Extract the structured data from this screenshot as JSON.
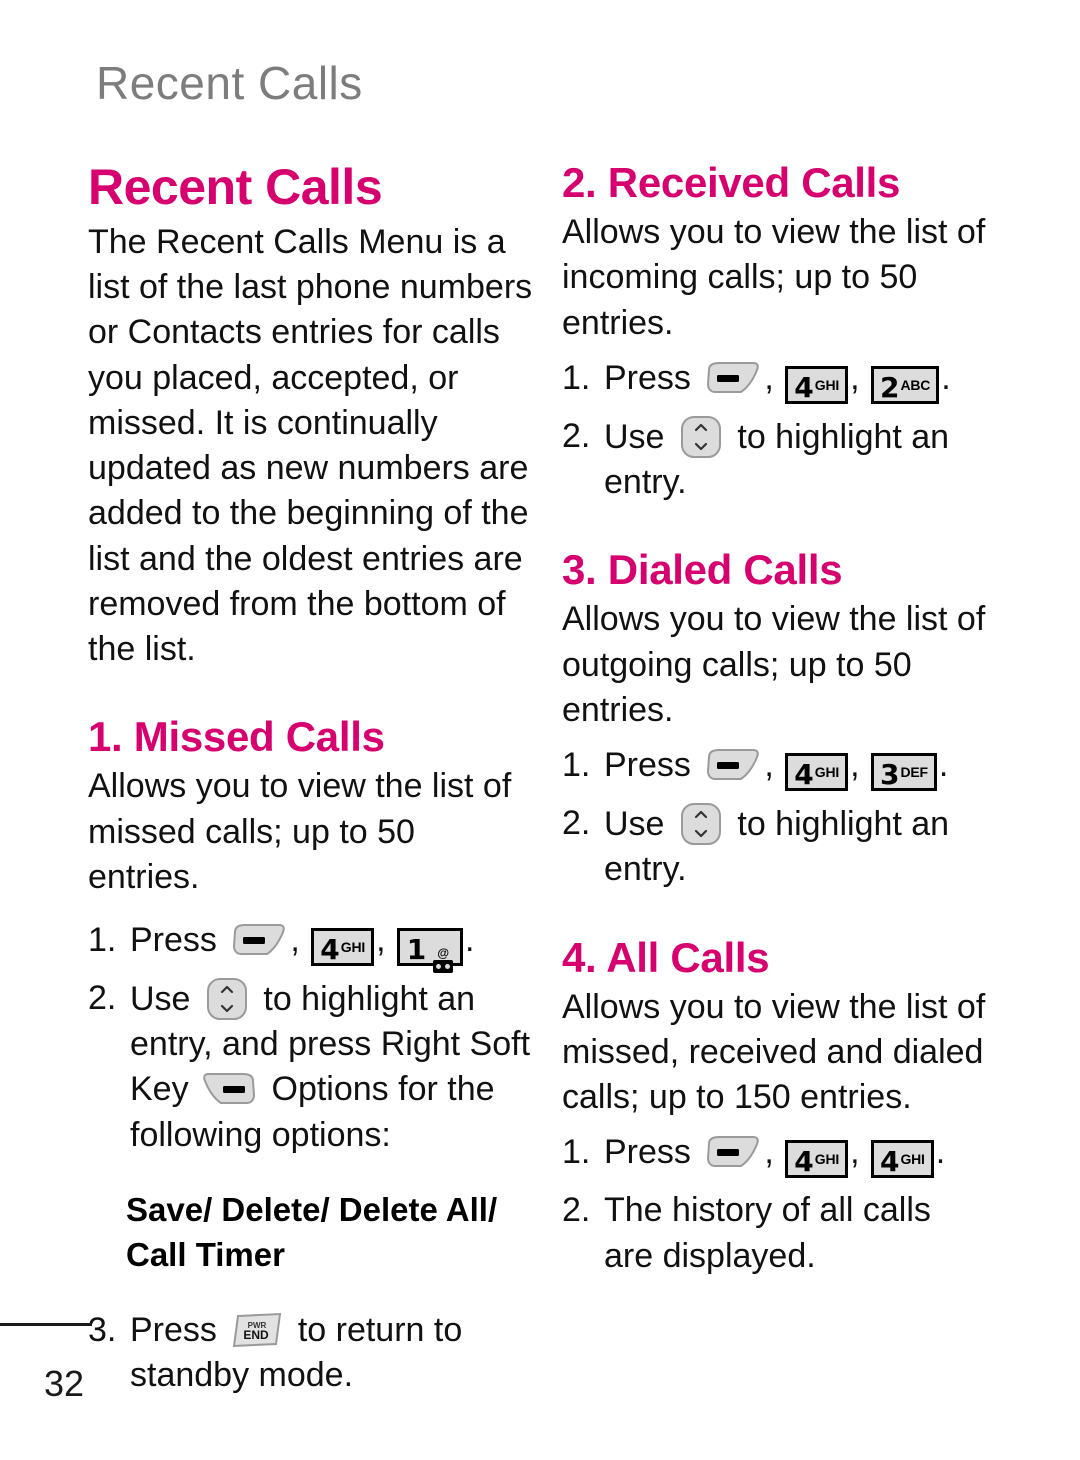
{
  "page": {
    "running_head": "Recent Calls",
    "page_number": "32",
    "accent_color": "#d6006e",
    "header_color": "#7d7d7d",
    "text_color": "#111111"
  },
  "left_column": {
    "title": "Recent Calls",
    "intro": "The Recent Calls Menu is a list of the last phone numbers or Contacts entries for calls you placed, accepted, or missed. It is continually updated as new numbers are added to the beginning of the list and the oldest entries are removed from the bottom of the list.",
    "section": {
      "heading": "1. Missed Calls",
      "description": "Allows you to view the list of missed calls; up to 50 entries.",
      "steps": [
        {
          "num": "1.",
          "pre": "Press",
          "keys": [
            "send-key",
            "4-ghi-key",
            "1-voicemail-key"
          ],
          "post": "."
        },
        {
          "num": "2.",
          "pre": "Use",
          "keys": [
            "nav-key"
          ],
          "post": "to highlight an entry, and press Right Soft Key",
          "post_keys": [
            "right-soft-key"
          ],
          "tail": "Options for the following options:"
        },
        {
          "num": "3.",
          "pre": "Press",
          "keys": [
            "pwr-end-key"
          ],
          "post": "to return to standby mode."
        }
      ],
      "options_bold": "Save/ Delete/ Delete All/ Call Timer"
    }
  },
  "right_column": {
    "sections": [
      {
        "heading": "2. Received Calls",
        "description": "Allows you to view the list of incoming calls; up to 50 entries.",
        "steps": [
          {
            "num": "1.",
            "pre": "Press",
            "keys": [
              "send-key",
              "4-ghi-key",
              "2-abc-key"
            ],
            "post": "."
          },
          {
            "num": "2.",
            "pre": "Use",
            "keys": [
              "nav-key"
            ],
            "post": "to highlight an entry."
          }
        ]
      },
      {
        "heading": "3. Dialed Calls",
        "description": "Allows you to view the list of outgoing calls; up to 50 entries.",
        "steps": [
          {
            "num": "1.",
            "pre": "Press",
            "keys": [
              "send-key",
              "4-ghi-key",
              "3-def-key"
            ],
            "post": "."
          },
          {
            "num": "2.",
            "pre": "Use",
            "keys": [
              "nav-key"
            ],
            "post": "to highlight an entry."
          }
        ]
      },
      {
        "heading": "4. All Calls",
        "description": "Allows you to view the list of missed, received and dialed calls; up to 150 entries.",
        "steps": [
          {
            "num": "1.",
            "pre": "Press",
            "keys": [
              "send-key",
              "4-ghi-key",
              "4-ghi-key"
            ],
            "post": "."
          },
          {
            "num": "2.",
            "pre": "The history of all calls are displayed.",
            "keys": []
          }
        ]
      }
    ]
  },
  "keys": {
    "four": {
      "digit": "4",
      "letters": "GHI"
    },
    "one": {
      "digit": "1",
      "at": "@"
    },
    "two": {
      "digit": "2",
      "letters": "ABC"
    },
    "three": {
      "digit": "3",
      "letters": "DEF"
    },
    "end": {
      "line1": "PWR",
      "line2": "END"
    }
  },
  "labels": {
    "press": "Press",
    "use": "Use",
    "comma": ",",
    "period": ".",
    "to_highlight_an": "to highlight an",
    "entry": "entry.",
    "entry_and_press": "entry, and press Right Soft",
    "key_word": "Key",
    "options_for_the": "Options for the",
    "following_options": "following options:",
    "to_return_to": "to return to",
    "standby_mode": "standby mode.",
    "step1": "1.",
    "step2": "2.",
    "step3": "3.",
    "history_line1": "The history of all calls are",
    "history_line2": "displayed."
  }
}
